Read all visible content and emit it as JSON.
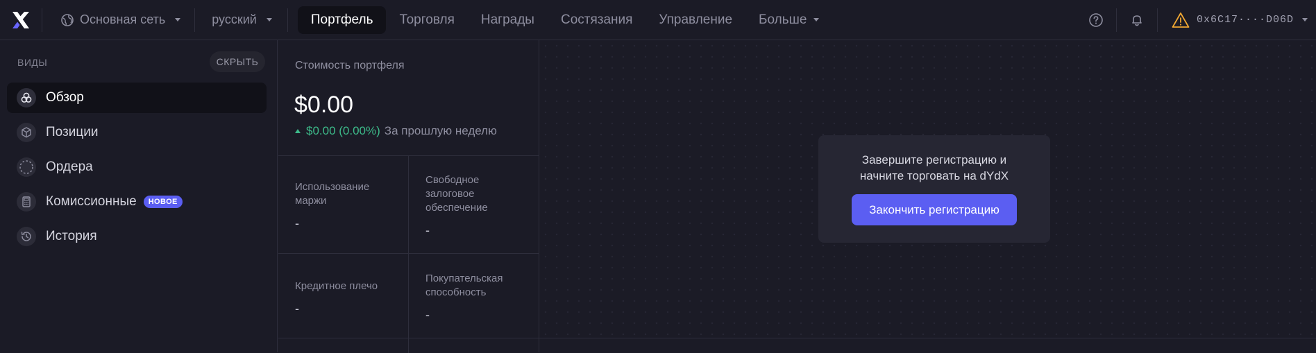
{
  "topbar": {
    "network_label": "Основная сеть",
    "language_label": "русский",
    "nav": [
      {
        "label": "Портфель",
        "active": true
      },
      {
        "label": "Торговля",
        "active": false
      },
      {
        "label": "Награды",
        "active": false
      },
      {
        "label": "Состязания",
        "active": false
      },
      {
        "label": "Управление",
        "active": false
      },
      {
        "label": "Больше",
        "active": false
      }
    ],
    "wallet_address": "0x6C17····D06D"
  },
  "sidebar": {
    "heading": "ВИДЫ",
    "hide_label": "СКРЫТЬ",
    "items": [
      {
        "label": "Обзор",
        "icon": "overview-icon"
      },
      {
        "label": "Позиции",
        "icon": "cube-icon"
      },
      {
        "label": "Ордера",
        "icon": "dashed-circle-icon"
      },
      {
        "label": "Комиссионные",
        "icon": "calculator-icon",
        "badge": "НОВОЕ"
      },
      {
        "label": "История",
        "icon": "history-icon"
      }
    ]
  },
  "portfolio": {
    "value_label": "Стоимость портфеля",
    "value": "$0.00",
    "change": "$0.00 (0.00%)",
    "change_period": "За прошлую неделю",
    "stats": [
      {
        "label": "Использование маржи",
        "value": "-"
      },
      {
        "label": "Свободное залоговое обеспечение",
        "value": "-"
      },
      {
        "label": "Кредитное плечо",
        "value": "-"
      },
      {
        "label": "Покупательская способность",
        "value": "-"
      }
    ]
  },
  "cta": {
    "text_line1": "Завершите регистрацию и",
    "text_line2": "начните торговать на dYdX",
    "button_label": "Закончить регистрацию"
  },
  "colors": {
    "accent": "#5b5ef2",
    "positive": "#3dbb8a",
    "warning": "#f0a732",
    "background": "#1b1b26"
  }
}
